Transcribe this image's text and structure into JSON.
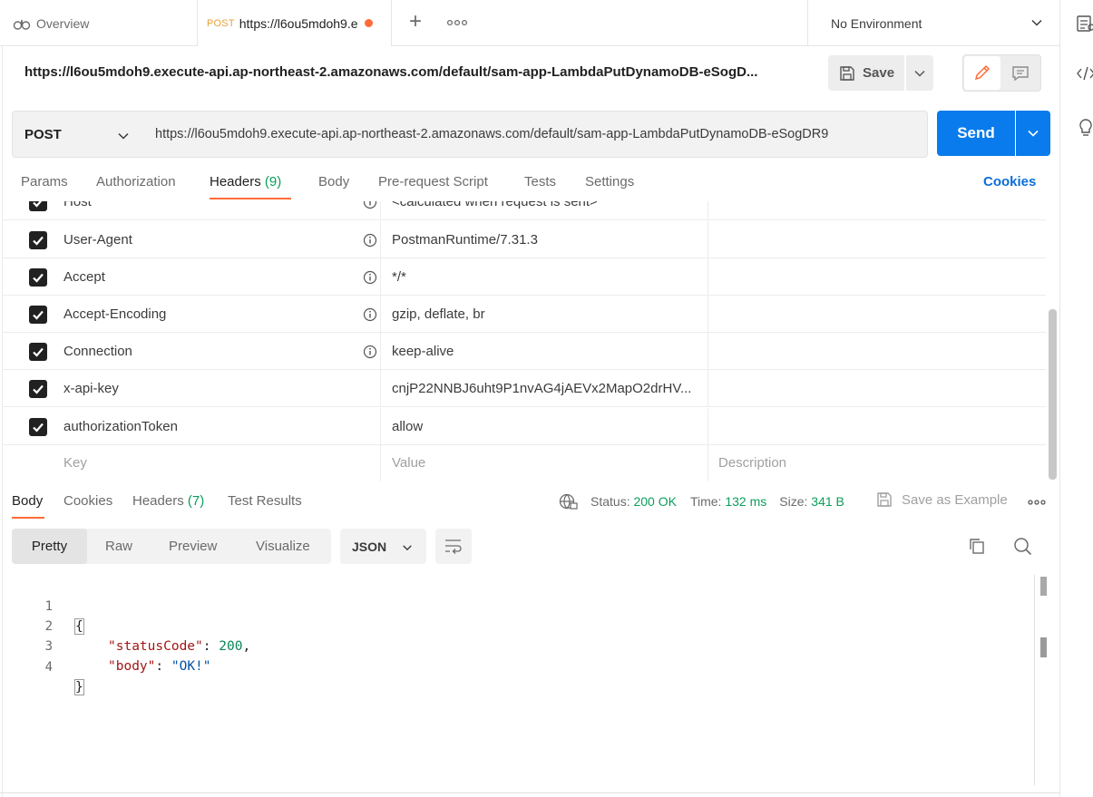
{
  "tabs": {
    "overview_label": "Overview",
    "active_method": "POST",
    "active_url": "https://l6ou5mdoh9.e"
  },
  "environment": {
    "label": "No Environment"
  },
  "request": {
    "title": "https://l6ou5mdoh9.execute-api.ap-northeast-2.amazonaws.com/default/sam-app-LambdaPutDynamoDB-eSogD...",
    "save_label": "Save",
    "method": "POST",
    "url": "https://l6ou5mdoh9.execute-api.ap-northeast-2.amazonaws.com/default/sam-app-LambdaPutDynamoDB-eSogDR9",
    "send_label": "Send"
  },
  "request_tabs": {
    "params": "Params",
    "authorization": "Authorization",
    "headers": "Headers",
    "headers_count": "(9)",
    "body": "Body",
    "prerequest": "Pre-request Script",
    "tests": "Tests",
    "settings": "Settings",
    "cookies": "Cookies"
  },
  "headers": [
    {
      "key": "Host",
      "value": "<calculated when request is sent>",
      "checked": true,
      "info": true
    },
    {
      "key": "User-Agent",
      "value": "PostmanRuntime/7.31.3",
      "checked": true,
      "info": true
    },
    {
      "key": "Accept",
      "value": "*/*",
      "checked": true,
      "info": true
    },
    {
      "key": "Accept-Encoding",
      "value": "gzip, deflate, br",
      "checked": true,
      "info": true
    },
    {
      "key": "Connection",
      "value": "keep-alive",
      "checked": true,
      "info": true
    },
    {
      "key": "x-api-key",
      "value": "cnjP22NNBJ6uht9P1nvAG4jAEVx2MapO2drHV...",
      "checked": true,
      "info": false
    },
    {
      "key": "authorizationToken",
      "value": "allow",
      "checked": true,
      "info": false
    }
  ],
  "headers_placeholder": {
    "key": "Key",
    "value": "Value",
    "description": "Description"
  },
  "response_tabs": {
    "body": "Body",
    "cookies": "Cookies",
    "headers": "Headers",
    "headers_count": "(7)",
    "test_results": "Test Results"
  },
  "response_meta": {
    "status_label": "Status:",
    "status_value": "200 OK",
    "time_label": "Time:",
    "time_value": "132 ms",
    "size_label": "Size:",
    "size_value": "341 B",
    "save_example": "Save as Example"
  },
  "view_modes": {
    "pretty": "Pretty",
    "raw": "Raw",
    "preview": "Preview",
    "visualize": "Visualize",
    "format": "JSON"
  },
  "code_lines": [
    {
      "num": "1",
      "text": "{"
    },
    {
      "num": "2",
      "key": "\"statusCode\"",
      "sep": ": ",
      "value": "200",
      "end": ","
    },
    {
      "num": "3",
      "key": "\"body\"",
      "sep": ": ",
      "value": "\"OK!\"",
      "end": ""
    },
    {
      "num": "4",
      "text": "}"
    }
  ],
  "colors": {
    "accent_orange": "#ff6c37",
    "send_blue": "#097bed",
    "status_green": "#0a9e5a",
    "link_blue": "#0b6ed9"
  }
}
